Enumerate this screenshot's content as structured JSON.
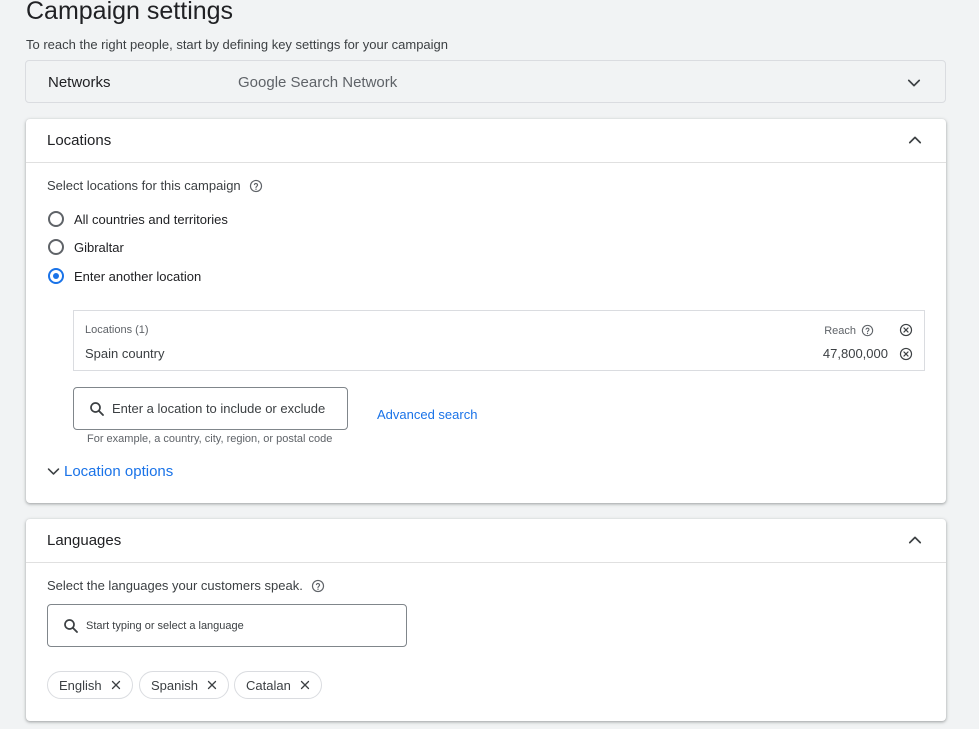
{
  "header": {
    "title": "Campaign settings",
    "subtitle": "To reach the right people, start by defining key settings for your campaign"
  },
  "networks": {
    "label": "Networks",
    "value": "Google Search Network"
  },
  "locations": {
    "title": "Locations",
    "prompt": "Select locations for this campaign",
    "options": [
      {
        "label": "All countries and territories",
        "checked": false
      },
      {
        "label": "Gibraltar",
        "checked": false
      },
      {
        "label": "Enter another location",
        "checked": true
      }
    ],
    "table": {
      "header_label": "Locations (1)",
      "reach_label": "Reach",
      "rows": [
        {
          "name": "Spain country",
          "reach": "47,800,000"
        }
      ]
    },
    "search": {
      "placeholder": "Enter a location to include or exclude",
      "hint": "For example, a country, city, region, or postal code"
    },
    "advanced_search": "Advanced search",
    "location_options": "Location options"
  },
  "languages": {
    "title": "Languages",
    "prompt": "Select the languages your customers speak.",
    "search_placeholder": "Start typing or select a language",
    "chips": [
      "English",
      "Spanish",
      "Catalan"
    ]
  },
  "colors": {
    "accent": "#1a73e8",
    "text": "#3c4043",
    "border": "#dadce0",
    "background": "#f1f3f4"
  },
  "icons": [
    "help-icon",
    "chevron-down-icon",
    "chevron-up-icon",
    "search-icon",
    "close-circle-icon",
    "close-icon"
  ]
}
